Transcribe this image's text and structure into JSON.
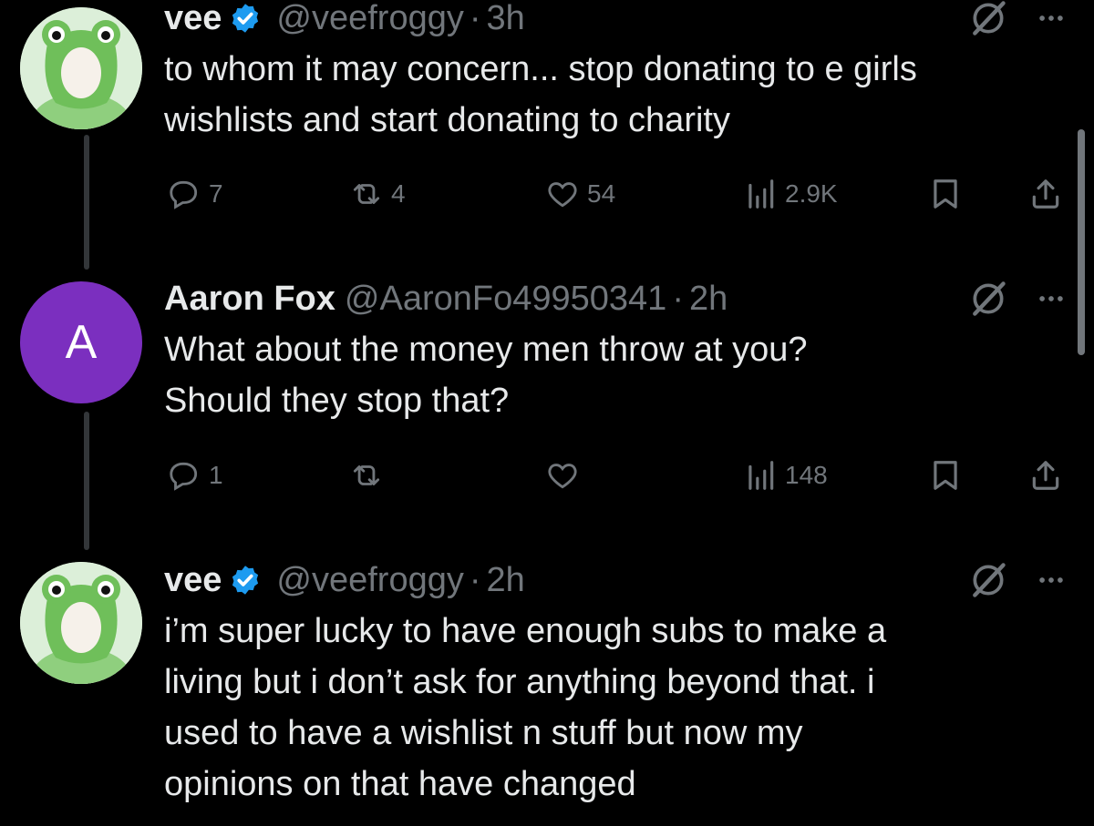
{
  "colors": {
    "background": "#000000",
    "text": "#e7e9ea",
    "muted": "#71767b",
    "verified": "#1d9bf0",
    "avatar_letter_bg": "#7b2fbf",
    "thread_line": "#333639"
  },
  "tweets": [
    {
      "name": "vee",
      "verified": true,
      "handle": "@veefroggy",
      "separator": "·",
      "time": "3h",
      "text_lines": [
        "to whom it may concern... stop donating to e girls",
        "wishlists and start donating to charity"
      ],
      "avatar": {
        "type": "frog-hat-icon"
      },
      "metrics": {
        "replies": "7",
        "reposts": "4",
        "likes": "54",
        "views": "2.9K"
      }
    },
    {
      "name": "Aaron Fox",
      "verified": false,
      "handle": "@AaronFo49950341",
      "separator": "·",
      "time": "2h",
      "text_lines": [
        "What about the money men throw at you?",
        "Should they stop that?"
      ],
      "avatar": {
        "type": "letter",
        "letter": "A"
      },
      "metrics": {
        "replies": "1",
        "reposts": "",
        "likes": "",
        "views": "148"
      }
    },
    {
      "name": "vee",
      "verified": true,
      "handle": "@veefroggy",
      "separator": "·",
      "time": "2h",
      "text_lines": [
        "i’m super lucky to have enough subs to make a",
        "living but i don’t ask for anything beyond that. i",
        "used to have a wishlist n stuff but now my",
        "opinions on that have changed"
      ],
      "avatar": {
        "type": "frog-hat-icon"
      }
    }
  ]
}
